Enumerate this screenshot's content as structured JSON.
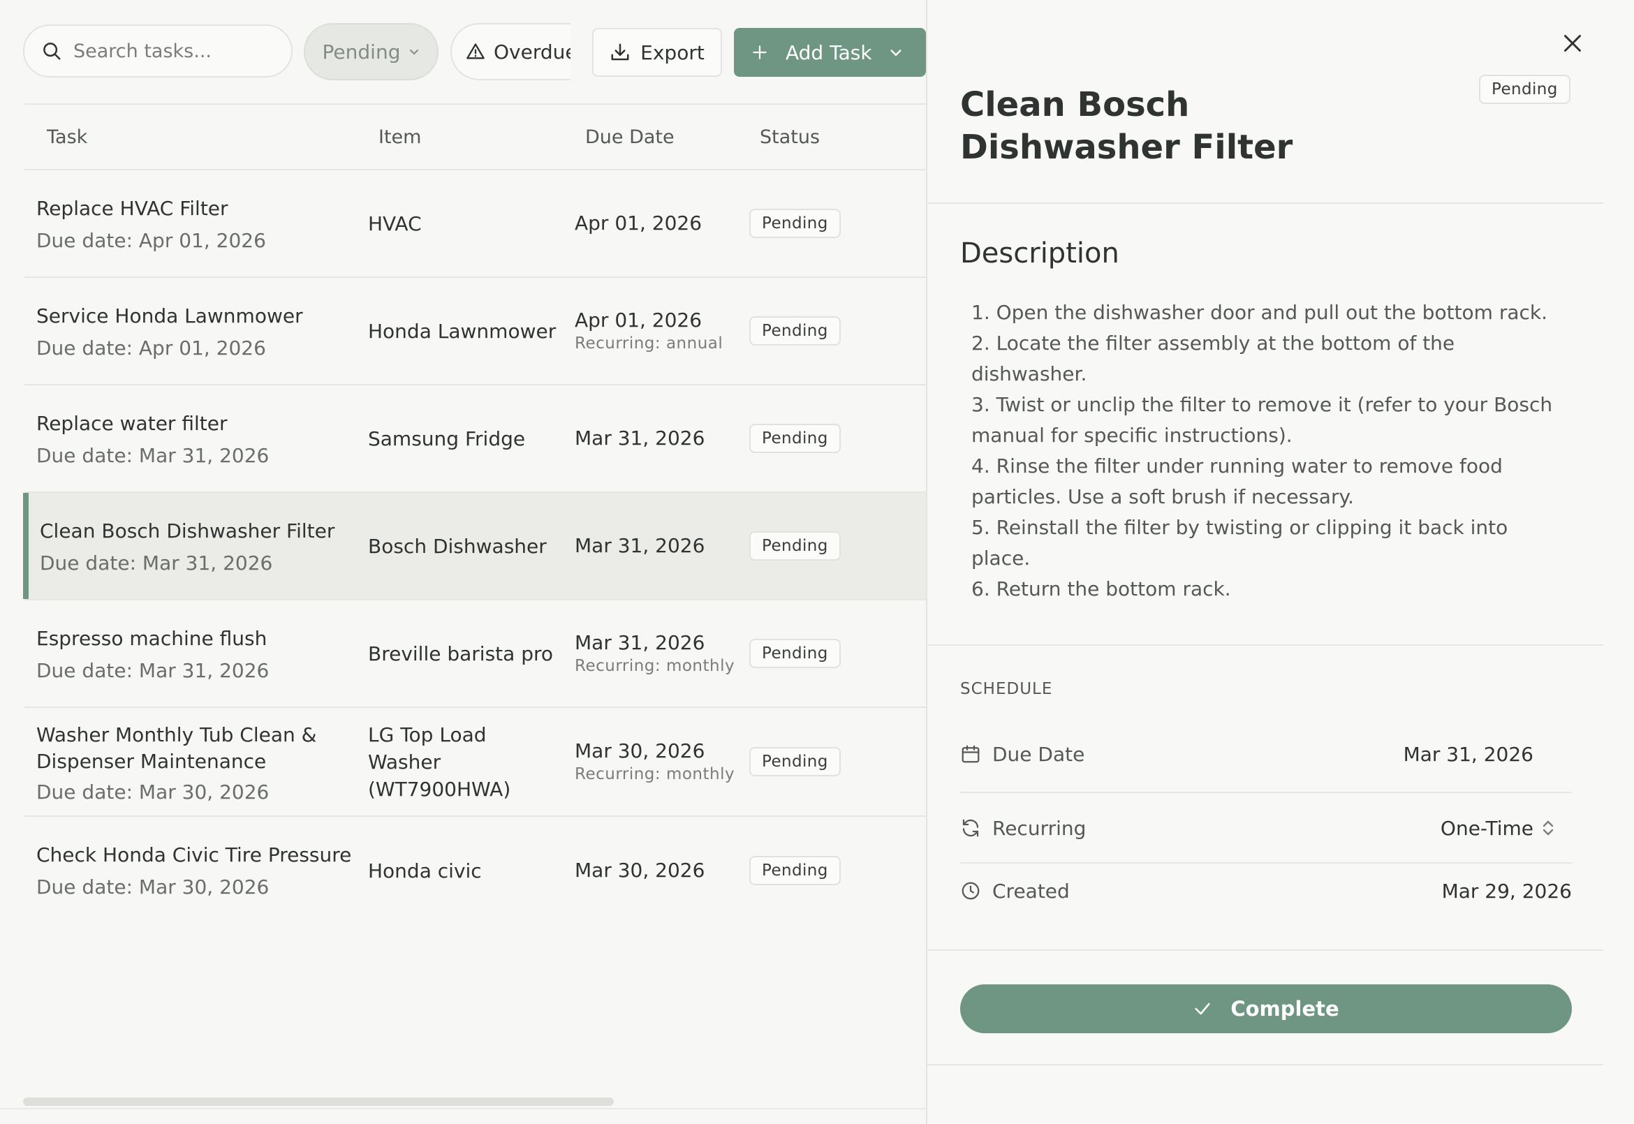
{
  "toolbar": {
    "search_placeholder": "Search tasks...",
    "filter_status": "Pending",
    "filter_overdue": "Overdue",
    "export_label": "Export",
    "add_task_label": "Add Task"
  },
  "table": {
    "headers": {
      "task": "Task",
      "item": "Item",
      "due": "Due Date",
      "status": "Status"
    },
    "rows": [
      {
        "title": "Replace HVAC Filter",
        "sub": "Due date: Apr 01, 2026",
        "item": "HVAC",
        "due": "Apr 01, 2026",
        "recurring": "",
        "status": "Pending"
      },
      {
        "title": "Service Honda Lawnmower",
        "sub": "Due date: Apr 01, 2026",
        "item": "Honda Lawnmower",
        "due": "Apr 01, 2026",
        "recurring": "Recurring: annual",
        "status": "Pending"
      },
      {
        "title": "Replace water filter",
        "sub": "Due date: Mar 31, 2026",
        "item": "Samsung Fridge",
        "due": "Mar 31, 2026",
        "recurring": "",
        "status": "Pending"
      },
      {
        "title": "Clean Bosch Dishwasher Filter",
        "sub": "Due date: Mar 31, 2026",
        "item": "Bosch Dishwasher",
        "due": "Mar 31, 2026",
        "recurring": "",
        "status": "Pending"
      },
      {
        "title": "Espresso machine flush",
        "sub": "Due date: Mar 31, 2026",
        "item": "Breville barista pro",
        "due": "Mar 31, 2026",
        "recurring": "Recurring: monthly",
        "status": "Pending"
      },
      {
        "title_line1": "Washer Monthly Tub Clean &",
        "title_line2": "Dispenser Maintenance",
        "sub": "Due date: Mar 30, 2026",
        "item_line1": "LG Top Load",
        "item_line2": "Washer",
        "item_line3": "(WT7900HWA)",
        "due": "Mar 30, 2026",
        "recurring": "Recurring: monthly",
        "status": "Pending"
      },
      {
        "title": "Check Honda Civic Tire Pressure",
        "sub": "Due date: Mar 30, 2026",
        "item": "Honda civic",
        "due": "Mar 30, 2026",
        "recurring": "",
        "status": "Pending"
      }
    ]
  },
  "detail": {
    "title": "Clean Bosch Dishwasher Filter",
    "status": "Pending",
    "description_heading": "Description",
    "steps": [
      "1. Open the dishwasher door and pull out the bottom rack.",
      "2. Locate the filter assembly at the bottom of the",
      "dishwasher.",
      "3. Twist or unclip the filter to remove it (refer to your Bosch",
      "manual for specific instructions).",
      "4. Rinse the filter under running water to remove food",
      "particles. Use a soft brush if necessary.",
      "5. Reinstall the filter by twisting or clipping it back into",
      "place.",
      "6. Return the bottom rack."
    ],
    "schedule_heading": "SCHEDULE",
    "due_label": "Due Date",
    "due_value": "Mar 31, 2026",
    "recurring_label": "Recurring",
    "recurring_value": "One-Time",
    "created_label": "Created",
    "created_value": "Mar 29, 2026",
    "complete_label": "Complete"
  },
  "colors": {
    "accent": "#6f9683",
    "background": "#f7f7f5",
    "selected_row": "#ebebe8"
  },
  "icons": {
    "search": "search-icon",
    "chevron": "chevron-down-icon",
    "warning": "warning-icon",
    "download": "download-icon",
    "plus": "plus-icon",
    "close": "close-icon",
    "calendar": "calendar-icon",
    "refresh": "refresh-icon",
    "clock": "clock-icon",
    "check": "check-icon",
    "updown": "updown-arrows-icon"
  }
}
